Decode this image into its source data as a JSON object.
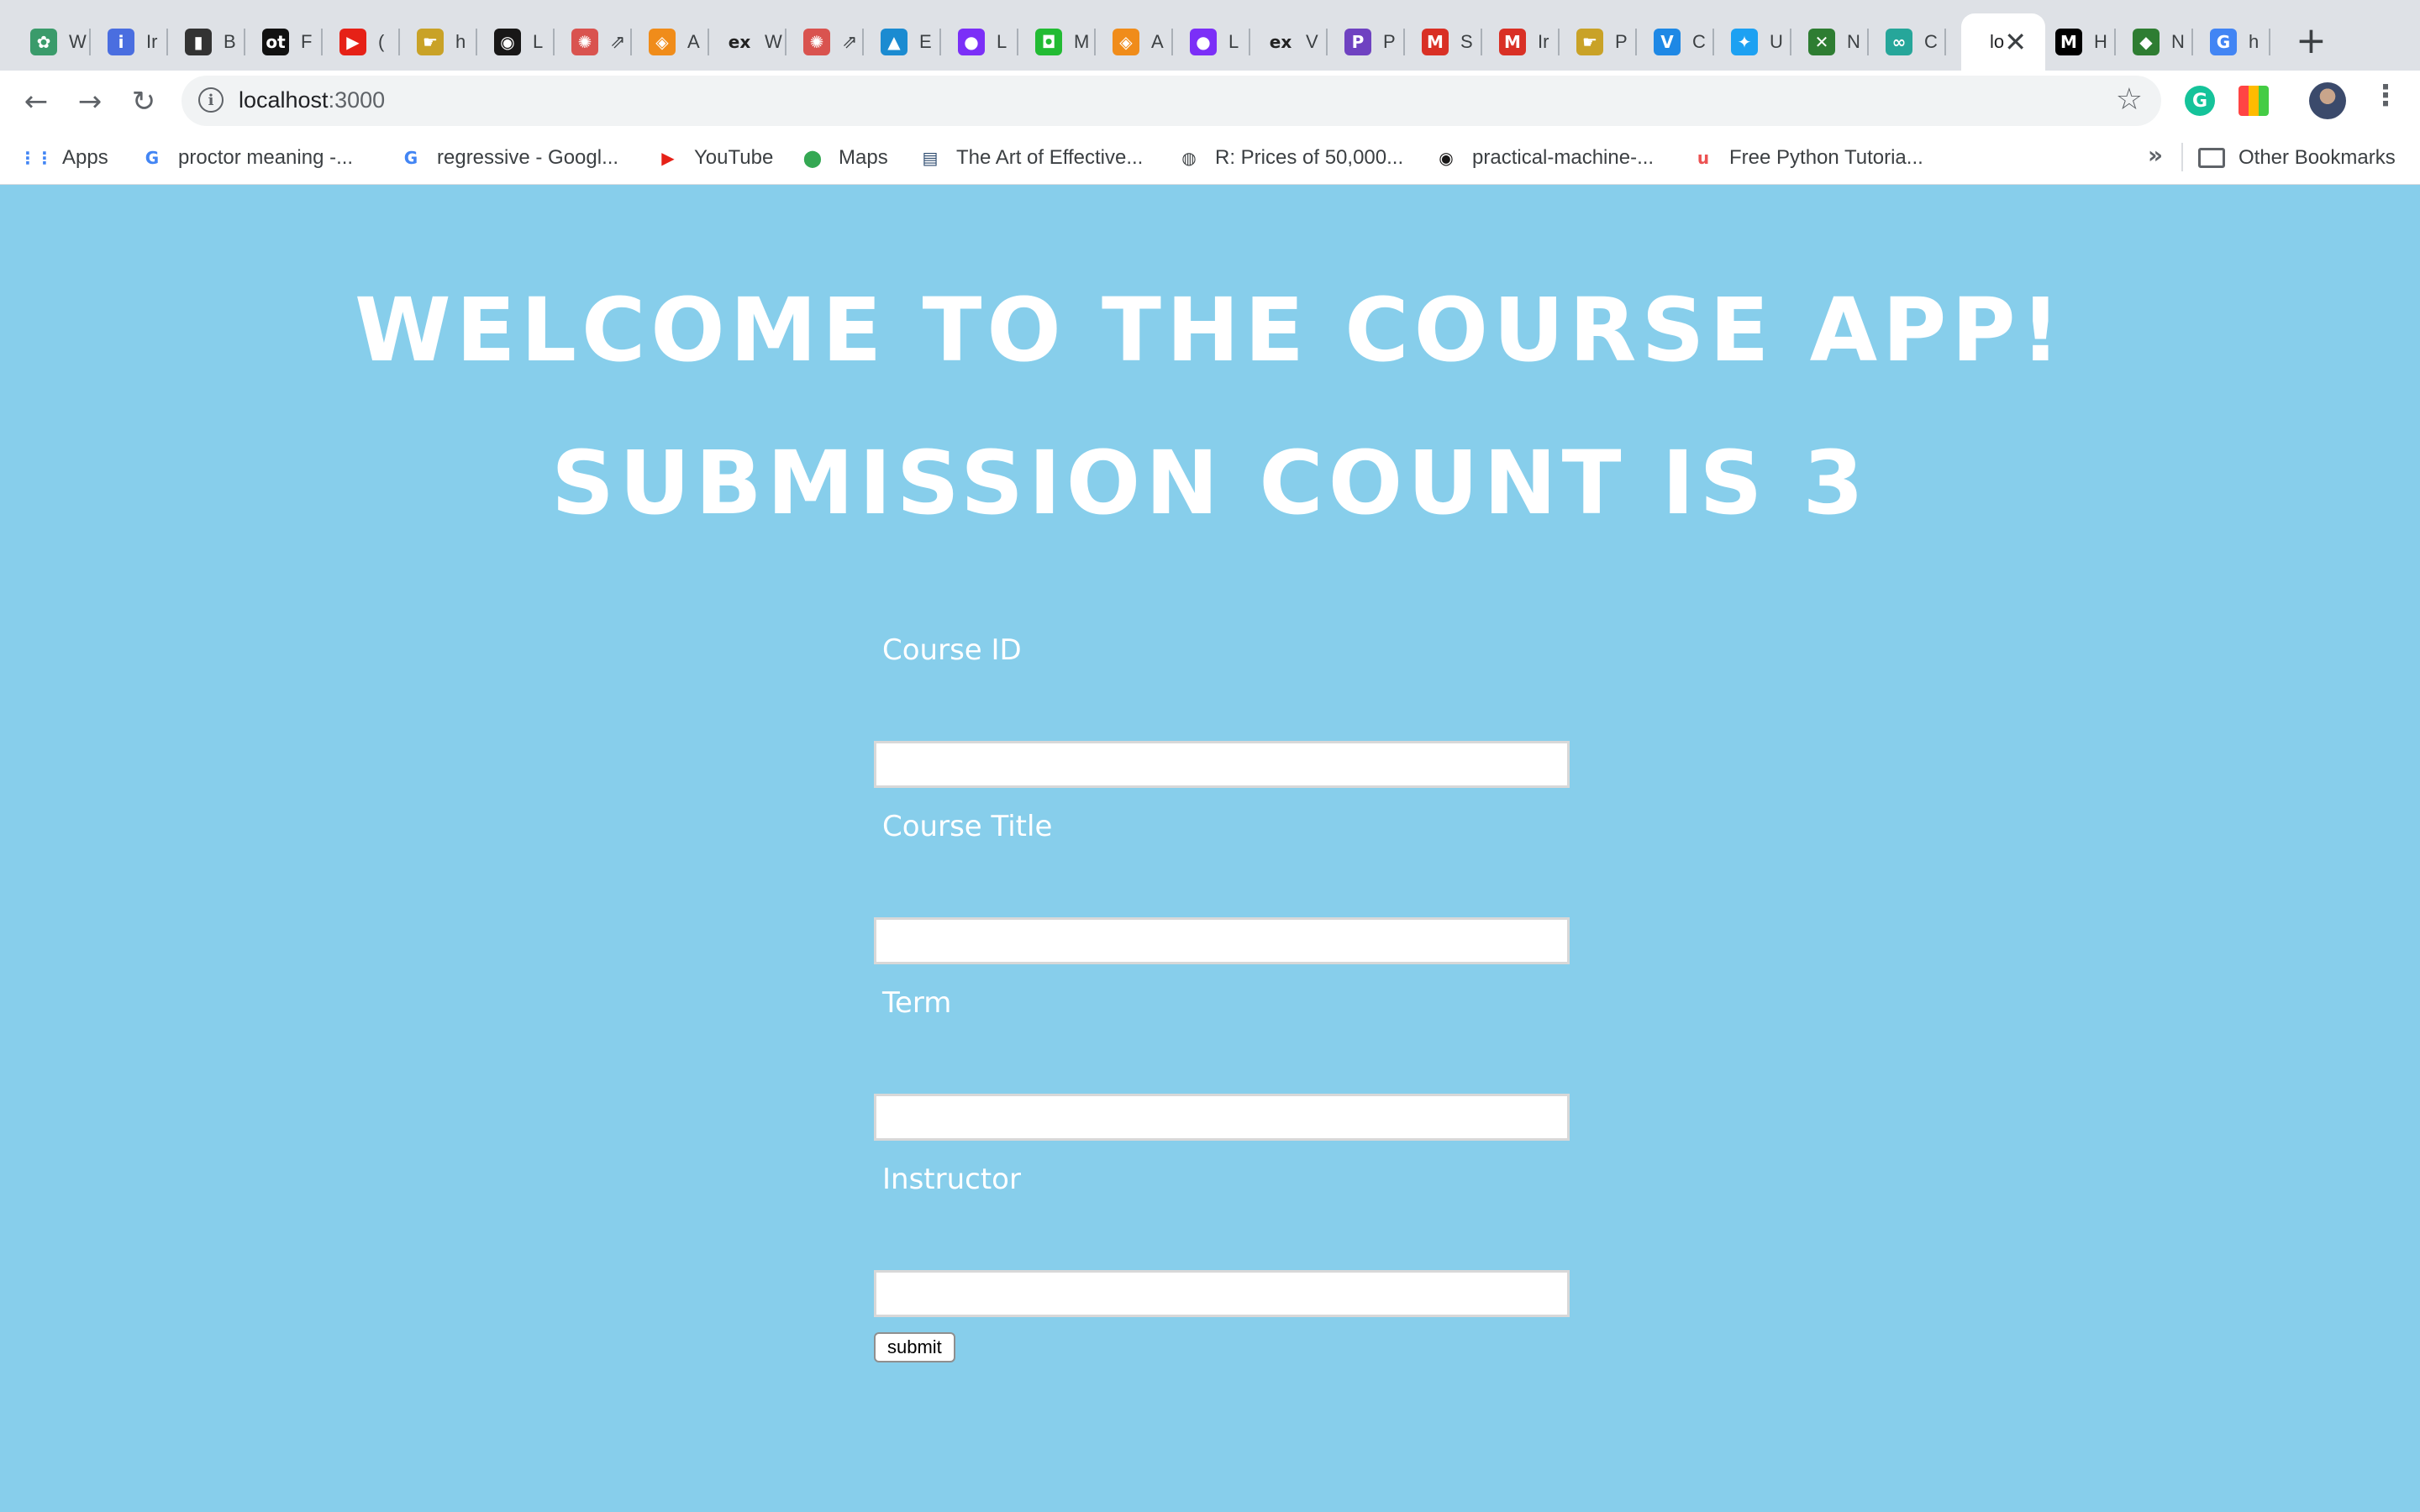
{
  "browser": {
    "tabs": [
      {
        "label": "W",
        "favicon": "lotus-icon",
        "color": "#3a9b6b"
      },
      {
        "label": "Ir",
        "favicon": "info-icon",
        "color": "#4a6ee0"
      },
      {
        "label": "B",
        "favicon": "notebook-icon",
        "color": "#333333"
      },
      {
        "label": "F",
        "favicon": "ot-icon",
        "color": "#111111"
      },
      {
        "label": "(",
        "favicon": "youtube-icon",
        "color": "#e62117"
      },
      {
        "label": "h",
        "favicon": "hand-icon",
        "color": "#c9a227"
      },
      {
        "label": "L",
        "favicon": "github-icon",
        "color": "#181717"
      },
      {
        "label": "⇗",
        "favicon": "wheel-icon",
        "color": "#d9534f"
      },
      {
        "label": "A",
        "favicon": "doc-icon",
        "color": "#f08c1a"
      },
      {
        "label": "W",
        "favicon": "ex-icon",
        "color": "#444444"
      },
      {
        "label": "⇗",
        "favicon": "wheel-icon",
        "color": "#d9534f"
      },
      {
        "label": "E",
        "favicon": "cap-icon",
        "color": "#1b8bd1"
      },
      {
        "label": "L",
        "favicon": "blob-icon",
        "color": "#7b2ff7"
      },
      {
        "label": "M",
        "favicon": "robot-icon",
        "color": "#22bb33"
      },
      {
        "label": "A",
        "favicon": "doc-icon",
        "color": "#f08c1a"
      },
      {
        "label": "L",
        "favicon": "blob-icon",
        "color": "#7b2ff7"
      },
      {
        "label": "V",
        "favicon": "ex-icon",
        "color": "#444444"
      },
      {
        "label": "P",
        "favicon": "p-icon",
        "color": "#6f42c1"
      },
      {
        "label": "S",
        "favicon": "gmail-icon",
        "color": "#d93025"
      },
      {
        "label": "Ir",
        "favicon": "gmail-icon",
        "color": "#d93025"
      },
      {
        "label": "P",
        "favicon": "hand-icon",
        "color": "#c9a227"
      },
      {
        "label": "C",
        "favicon": "v-icon",
        "color": "#1e88e5"
      },
      {
        "label": "U",
        "favicon": "twitter-icon",
        "color": "#1da1f2"
      },
      {
        "label": "N",
        "favicon": "x-icon",
        "color": "#2e7d32"
      },
      {
        "label": "C",
        "favicon": "link-icon",
        "color": "#26a69a"
      },
      {
        "label": "lo",
        "favicon": "none",
        "color": "#ffffff",
        "active": true
      },
      {
        "label": "H",
        "favicon": "medium-icon",
        "color": "#000000"
      },
      {
        "label": "N",
        "favicon": "diamond-icon",
        "color": "#2e7d32"
      },
      {
        "label": "h",
        "favicon": "google-icon",
        "color": "#4285f4"
      }
    ],
    "address": {
      "host": "localhost",
      "port": ":3000"
    },
    "bookmarks": [
      {
        "label": "Apps",
        "icon": "apps-grid-icon",
        "color": "#4285f4"
      },
      {
        "label": "proctor meaning -...",
        "icon": "google-icon",
        "color": "#4285f4"
      },
      {
        "label": "regressive - Googl...",
        "icon": "google-icon",
        "color": "#4285f4"
      },
      {
        "label": "YouTube",
        "icon": "youtube-icon",
        "color": "#e62117"
      },
      {
        "label": "Maps",
        "icon": "maps-pin-icon",
        "color": "#34a853"
      },
      {
        "label": "The Art of Effective...",
        "icon": "book-icon",
        "color": "#2c4a6e"
      },
      {
        "label": "R: Prices of 50,000...",
        "icon": "globe-icon",
        "color": "#3c4043"
      },
      {
        "label": "practical-machine-...",
        "icon": "github-icon",
        "color": "#181717"
      },
      {
        "label": "Free Python Tutoria...",
        "icon": "udemy-icon",
        "color": "#ec5252"
      }
    ],
    "other_bookmarks": "Other Bookmarks"
  },
  "page": {
    "title": "WELCOME TO THE COURSE APP!",
    "submission_count": "SUBMISSION COUNT IS 3",
    "form": {
      "fields": [
        {
          "label": "Course ID",
          "value": ""
        },
        {
          "label": "Course Title",
          "value": ""
        },
        {
          "label": "Term",
          "value": ""
        },
        {
          "label": "Instructor",
          "value": ""
        }
      ],
      "submit_label": "submit"
    }
  },
  "colors": {
    "background": "#87ceeb",
    "text": "#ffffff"
  }
}
